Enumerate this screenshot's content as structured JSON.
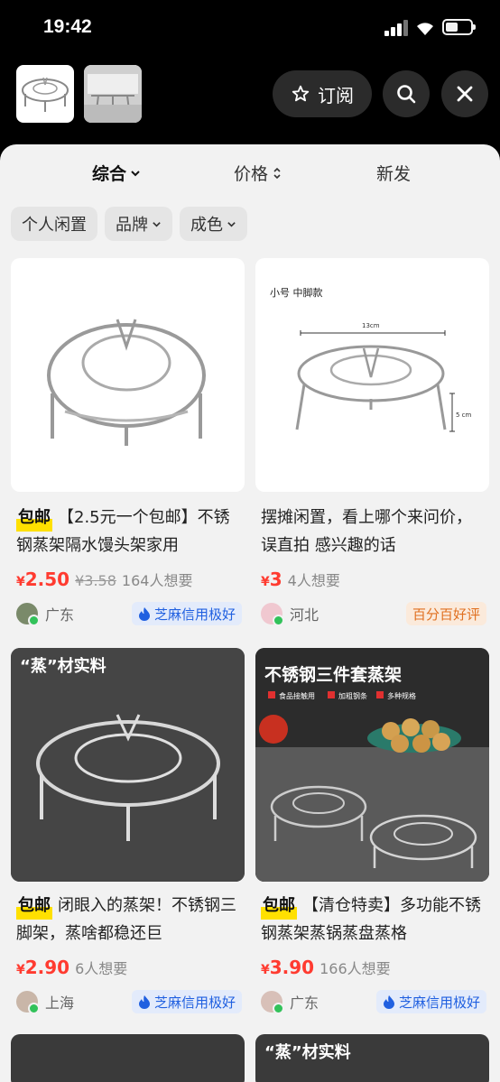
{
  "status": {
    "time": "19:42"
  },
  "topbar": {
    "subscribe_label": "订阅"
  },
  "sort": {
    "items": [
      "综合",
      "价格",
      "新发"
    ]
  },
  "filters": {
    "chips": [
      "个人闲置",
      "品牌",
      "成色"
    ]
  },
  "products": [
    {
      "image_text": [
        "",
        ""
      ],
      "tag": "包邮",
      "title": "【2.5元一个包邮】不锈钢蒸架隔水馒头架家用",
      "price": "2.50",
      "original_price": "¥3.58",
      "wants": "164人想要",
      "location": "广东",
      "badge": "芝麻信用极好"
    },
    {
      "image_text": [
        "小号  中脚款",
        "13cm",
        "5 cm"
      ],
      "tag": "",
      "title": "摆摊闲置，看上哪个来问价，误直拍 感兴趣的话",
      "price": "3",
      "original_price": "",
      "wants": "4人想要",
      "location": "河北",
      "badge": "百分百好评"
    },
    {
      "image_text": [
        "“蒸”材实料"
      ],
      "tag": "包邮",
      "title": "闭眼入的蒸架！不锈钢三脚架，蒸啥都稳还巨",
      "price": "2.90",
      "original_price": "",
      "wants": "6人想要",
      "location": "上海",
      "badge": "芝麻信用极好"
    },
    {
      "image_text": [
        "不锈钢三件套蒸架",
        "食品接触用",
        "加粗钢条",
        "多种规格"
      ],
      "tag": "包邮",
      "title": "【清仓特卖】多功能不锈钢蒸架蒸锅蒸盘蒸格",
      "price": "3.90",
      "original_price": "",
      "wants": "166人想要",
      "location": "广东",
      "badge": "芝麻信用极好"
    }
  ],
  "bottom_peek": {
    "right_text": "“蒸”材实料"
  },
  "currency": "¥",
  "colors": {
    "price": "#ff3b30",
    "zhima": "#2060e0",
    "tag_highlight": "#ffe000"
  }
}
